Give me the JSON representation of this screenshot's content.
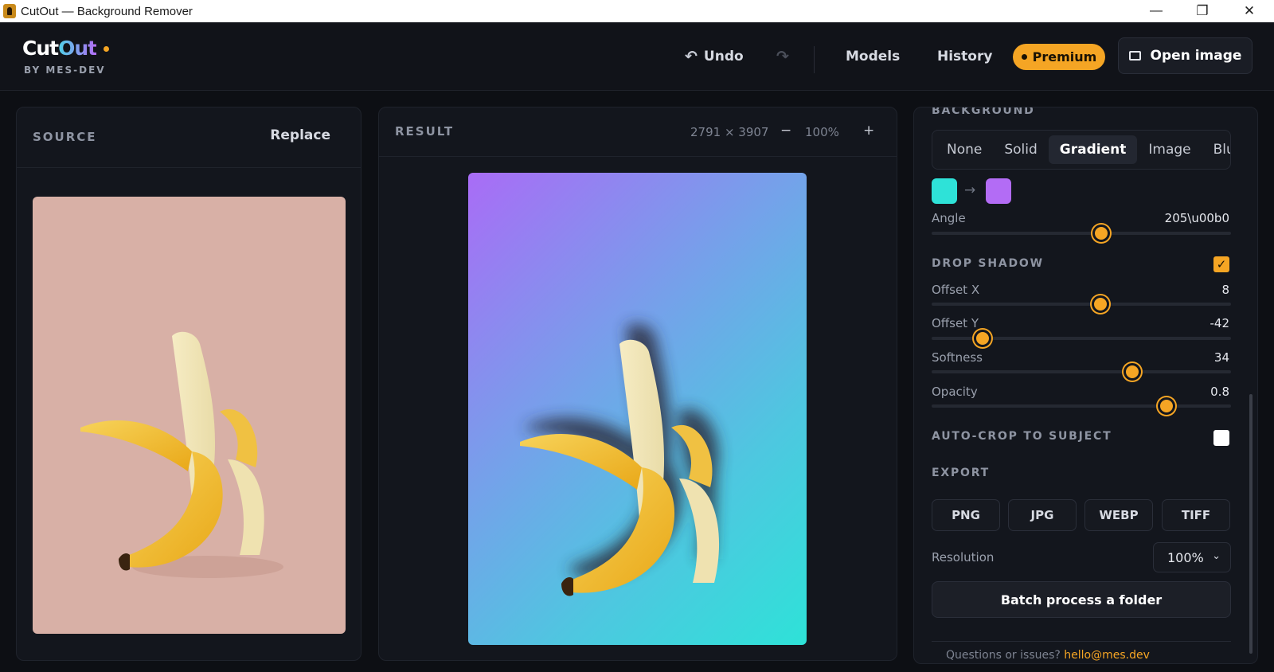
{
  "window": {
    "title": "CutOut — Background Remover",
    "minimize": "—",
    "maximize": "❐",
    "close": "✕"
  },
  "header": {
    "logo_cut": "Cut",
    "logo_out": "Out",
    "byline": "BY MES-DEV",
    "undo_label": "Undo",
    "undo_icon": "↶",
    "redo_icon": "↷",
    "models_label": "Models",
    "history_label": "History",
    "premium_label": "Premium",
    "open_label": "Open image"
  },
  "source": {
    "title": "SOURCE",
    "replace_label": "Replace"
  },
  "result": {
    "title": "RESULT",
    "dimensions": "2791 × 3907",
    "zoom_minus": "−",
    "zoom": "100%",
    "zoom_plus": "+"
  },
  "background": {
    "title": "BACKGROUND",
    "options": [
      "None",
      "Solid",
      "Gradient",
      "Image",
      "Blur"
    ],
    "active": "Gradient",
    "gradient_arrow": "→",
    "color_start": "#2ee2d8",
    "color_end": "#b36cf5",
    "angle_label": "Angle",
    "angle_value": "205\\u00b0",
    "angle_fraction": 0.566
  },
  "drop_shadow": {
    "title": "DROP SHADOW",
    "checkmark": "✓",
    "enabled": true,
    "sliders": [
      {
        "label": "Offset X",
        "value": "8",
        "fraction": 0.563
      },
      {
        "label": "Offset Y",
        "value": "-42",
        "fraction": 0.17
      },
      {
        "label": "Softness",
        "value": "34",
        "fraction": 0.67
      },
      {
        "label": "Opacity",
        "value": "0.8",
        "fraction": 0.785
      }
    ]
  },
  "auto_crop": {
    "title": "AUTO-CROP TO SUBJECT",
    "enabled": false
  },
  "export": {
    "title": "EXPORT",
    "formats": [
      "PNG",
      "JPG",
      "WEBP",
      "TIFF"
    ],
    "resolution_label": "Resolution",
    "resolution_value": "100%",
    "chevron": "⌄",
    "batch_label": "Batch process a folder"
  },
  "footer": {
    "text": "Questions or issues? ",
    "link": "hello@mes.dev"
  },
  "colors": {
    "accent": "#f5a524",
    "panel": "#13161d",
    "background": "#0d0f14"
  }
}
